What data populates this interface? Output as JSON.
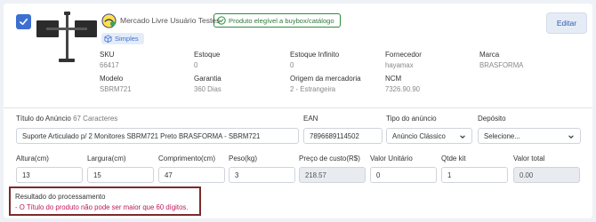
{
  "header": {
    "seller_name": "Mercado Livre Usuário Testes",
    "buybox_label": "Produto elegível a buybox/catálogo",
    "type_badge": "Simples",
    "edit_label": "Editar"
  },
  "details": {
    "sku_label": "SKU",
    "sku_value": "66417",
    "estoque_label": "Estoque",
    "estoque_value": "0",
    "estoque_inf_label": "Estoque Infinito",
    "estoque_inf_value": "0",
    "fornecedor_label": "Fornecedor",
    "fornecedor_value": "hayamax",
    "marca_label": "Marca",
    "marca_value": "BRASFORMA",
    "modelo_label": "Modelo",
    "modelo_value": "SBRM721",
    "garantia_label": "Garantia",
    "garantia_value": "360 Dias",
    "origem_label": "Origem da mercadoria",
    "origem_value": "2 - Estrangeira",
    "ncm_label": "NCM",
    "ncm_value": "7326.90.90"
  },
  "form": {
    "titulo_label": "Título do Anúncio",
    "titulo_count": "67 Caracteres",
    "titulo_value": "Suporte Articulado p/ 2 Monitores SBRM721 Preto BRASFORMA - SBRM721",
    "ean_label": "EAN",
    "ean_value": "7896689114502",
    "tipo_label": "Tipo do anúncio",
    "tipo_value": "Anúncio Clássico",
    "deposito_label": "Depósito",
    "deposito_value": "Selecione...",
    "altura_label": "Altura(cm)",
    "altura_value": "13",
    "largura_label": "Largura(cm)",
    "largura_value": "15",
    "comprimento_label": "Comprimento(cm)",
    "comprimento_value": "47",
    "peso_label": "Peso(kg)",
    "peso_value": "3",
    "custo_label": "Preço de custo(R$)",
    "custo_value": "218.57",
    "unitario_label": "Valor Unitário",
    "unitario_value": "0",
    "qtde_label": "Qtde kit",
    "qtde_value": "1",
    "total_label": "Valor total",
    "total_value": "0.00"
  },
  "result": {
    "title": "Resultado do processamento",
    "error": "- O Título do produto não pode ser maior que 60 dígitos."
  },
  "colors": {
    "accent": "#3d6fd1",
    "buybox_green": "#2f8a3c",
    "error_text": "#c0175b",
    "result_border": "#7b2b2b"
  },
  "icons": {
    "checkbox": "check-icon",
    "seller": "mercado-livre-icon",
    "buybox": "check-circle-icon",
    "simple": "box-icon",
    "select": "chevron-down-icon"
  }
}
